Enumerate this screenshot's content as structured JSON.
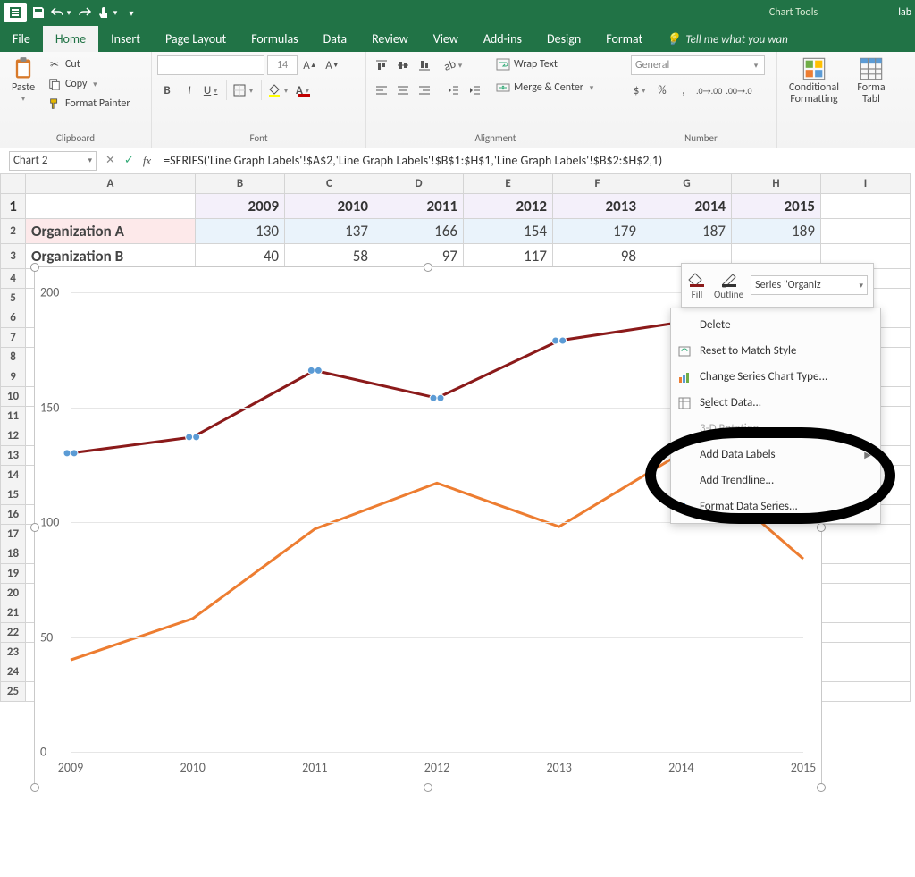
{
  "titlebar": {
    "chart_tools": "Chart Tools",
    "filename": "lab"
  },
  "tabs": {
    "file": "File",
    "home": "Home",
    "insert": "Insert",
    "pagelayout": "Page Layout",
    "formulas": "Formulas",
    "data": "Data",
    "review": "Review",
    "view": "View",
    "addins": "Add-ins",
    "design": "Design",
    "format": "Format",
    "tellme": "Tell me what you wan"
  },
  "ribbon": {
    "clipboard": {
      "paste": "Paste",
      "cut": "Cut",
      "copy": "Copy",
      "format_painter": "Format Painter",
      "label": "Clipboard"
    },
    "font": {
      "name_placeholder": "",
      "size": "14",
      "bold": "B",
      "italic": "I",
      "underline": "U",
      "label": "Font"
    },
    "alignment": {
      "wrap": "Wrap Text",
      "merge": "Merge & Center",
      "label": "Alignment"
    },
    "number": {
      "format": "General",
      "label": "Number"
    },
    "styles": {
      "cond": "Conditional\nFormatting",
      "table": "Forma\nTabl"
    }
  },
  "fxbar": {
    "namebox": "Chart 2",
    "formula": "=SERIES('Line Graph Labels'!$A$2,'Line Graph Labels'!$B$1:$H$1,'Line Graph Labels'!$B$2:$H$2,1)"
  },
  "sheet": {
    "cols": [
      "A",
      "B",
      "C",
      "D",
      "E",
      "F",
      "G",
      "H",
      "I"
    ],
    "years": [
      "2009",
      "2010",
      "2011",
      "2012",
      "2013",
      "2014",
      "2015"
    ],
    "rows": [
      {
        "label": "Organization A",
        "vals": [
          "130",
          "137",
          "166",
          "154",
          "179",
          "187",
          "189"
        ]
      },
      {
        "label": "Organization B",
        "vals": [
          "40",
          "58",
          "97",
          "117",
          "98",
          "",
          ""
        ]
      }
    ]
  },
  "chart_data": {
    "type": "line",
    "categories": [
      "2009",
      "2010",
      "2011",
      "2012",
      "2013",
      "2014",
      "2015"
    ],
    "series": [
      {
        "name": "Organization A",
        "values": [
          130,
          137,
          166,
          154,
          179,
          187,
          189
        ],
        "color": "#8b1a1a"
      },
      {
        "name": "Organization B",
        "values": [
          40,
          58,
          97,
          117,
          98,
          130,
          84
        ],
        "color": "#ed7d31"
      }
    ],
    "ylim": [
      0,
      200
    ],
    "yticks": [
      0,
      50,
      100,
      150,
      200
    ],
    "xlabel": "",
    "ylabel": "",
    "title": ""
  },
  "mini_toolbar": {
    "fill": "Fill",
    "outline": "Outline",
    "selector": "Series \"Organiz"
  },
  "ctx_menu": {
    "delete": "Delete",
    "reset": "Reset to Match Style",
    "change_type": "Change Series Chart Type...",
    "select_data": "Select Data...",
    "rotation": "3-D Rotation...",
    "add_labels": "Add Data Labels",
    "add_trendline": "Add Trendline...",
    "format_series": "Format Data Series..."
  }
}
